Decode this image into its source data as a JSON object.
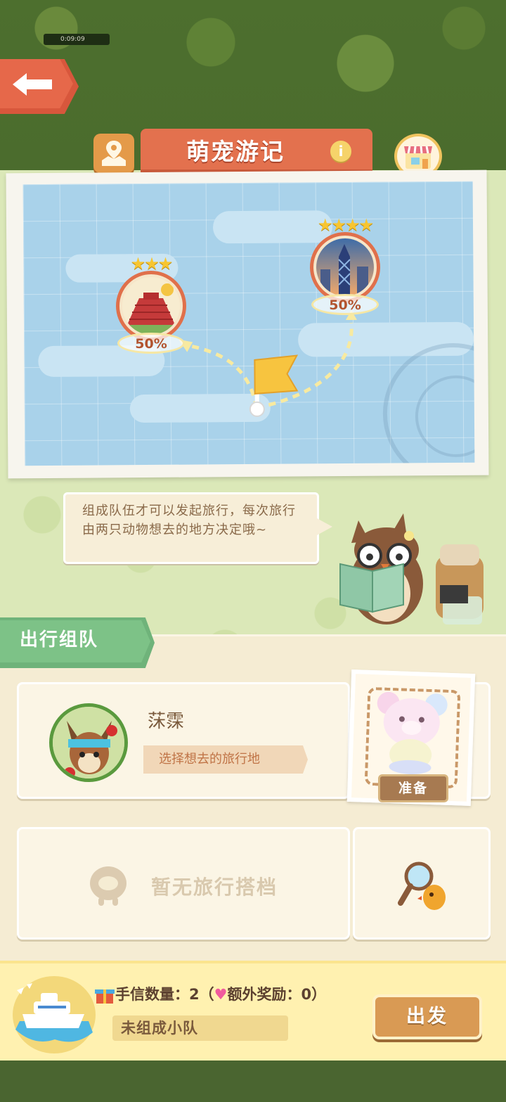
{
  "topbar": {
    "timer": "0:09:09"
  },
  "header": {
    "title": "萌宠游记",
    "info_icon": "i"
  },
  "map": {
    "destinations": [
      {
        "name": "pyramid",
        "stars": 3,
        "stars_text": "★★★",
        "progress": "50%"
      },
      {
        "name": "city",
        "stars": 4,
        "stars_text": "★★★★",
        "progress": "50%"
      }
    ]
  },
  "bubble": {
    "text": "组成队伍才可以发起旅行，每次旅行由两只动物想去的地方决定哦~"
  },
  "team": {
    "title": "出行组队",
    "member": {
      "name": "莯霂",
      "select_label": "选择想去的旅行地",
      "ready_label": "准备"
    },
    "partner": {
      "empty_label": "暂无旅行搭档"
    }
  },
  "footer": {
    "letters_label": "手信数量：2（",
    "bonus_label": "额外奖励：0）",
    "status": "未组成小队",
    "depart_label": "出发"
  },
  "colors": {
    "accent": "#e3714e",
    "panel": "#dbe8b8",
    "card": "#fbf5e5",
    "button": "#d99a54"
  }
}
